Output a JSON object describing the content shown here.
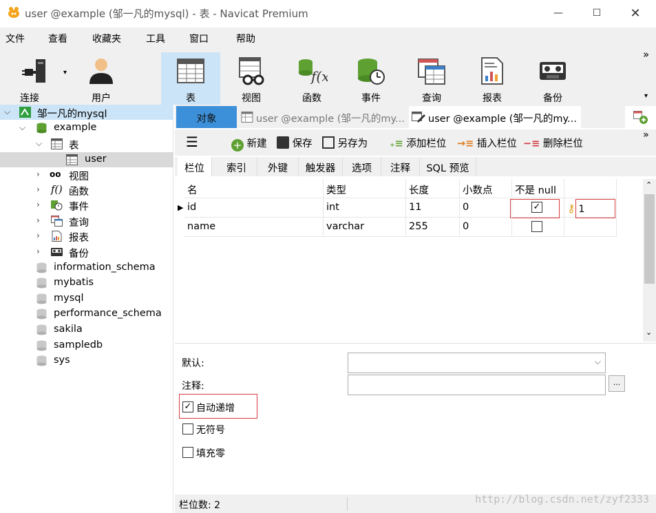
{
  "window": {
    "title": "user @example (邹一凡的mysql) - 表 - Navicat Premium",
    "min_glyph": "—",
    "max_glyph": "☐",
    "close_glyph": "✕"
  },
  "menu": [
    "文件",
    "查看",
    "收藏夹",
    "工具",
    "窗口",
    "帮助"
  ],
  "toolbar": {
    "buttons": [
      {
        "label": "连接",
        "icon": "connection-icon"
      },
      {
        "label": "用户",
        "icon": "user-icon"
      },
      {
        "label": "表",
        "icon": "table-icon",
        "selected": true
      },
      {
        "label": "视图",
        "icon": "view-icon"
      },
      {
        "label": "函数",
        "icon": "function-icon"
      },
      {
        "label": "事件",
        "icon": "event-icon"
      },
      {
        "label": "查询",
        "icon": "query-icon"
      },
      {
        "label": "报表",
        "icon": "report-icon"
      },
      {
        "label": "备份",
        "icon": "backup-icon"
      }
    ],
    "more": "»",
    "dropdown": "▾"
  },
  "sidebar": {
    "connection": "邹一凡的mysql",
    "database": "example",
    "table_group": "表",
    "table": "user",
    "groups": [
      "视图",
      "函数",
      "事件",
      "查询",
      "报表",
      "备份"
    ],
    "other_dbs": [
      "information_schema",
      "mybatis",
      "mysql",
      "performance_schema",
      "sakila",
      "sampledb",
      "sys"
    ]
  },
  "tabs": {
    "objects": "对象",
    "tab1": "user @example (邹一凡的my...",
    "tab2": "user @example (邹一凡的my..."
  },
  "subtoolbar": {
    "menu": "☰",
    "new": "新建",
    "save": "保存",
    "save_as": "另存为",
    "add_field": "添加栏位",
    "insert_field": "插入栏位",
    "delete_field": "删除栏位",
    "more": "»"
  },
  "field_tabs": [
    "栏位",
    "索引",
    "外键",
    "触发器",
    "选项",
    "注释",
    "SQL 预览"
  ],
  "grid": {
    "headers": [
      "名",
      "类型",
      "长度",
      "小数点",
      "不是 null"
    ],
    "rows": [
      {
        "name": "id",
        "type": "int",
        "length": "11",
        "decimals": "0",
        "not_null": true,
        "key": "1"
      },
      {
        "name": "name",
        "type": "varchar",
        "length": "255",
        "decimals": "0",
        "not_null": false,
        "key": ""
      }
    ]
  },
  "props": {
    "default_label": "默认:",
    "comment_label": "注释:",
    "browse": "...",
    "auto_increment": "自动递增",
    "unsigned": "无符号",
    "zerofill": "填充零",
    "auto_increment_checked": true
  },
  "status": {
    "field_count": "栏位数: 2"
  },
  "watermark": "http://blog.csdn.net/zyf2333",
  "colors": {
    "selected_bg": "#cce4f7",
    "active_tab": "#3c8fd9",
    "highlight_box": "#d9393e"
  }
}
